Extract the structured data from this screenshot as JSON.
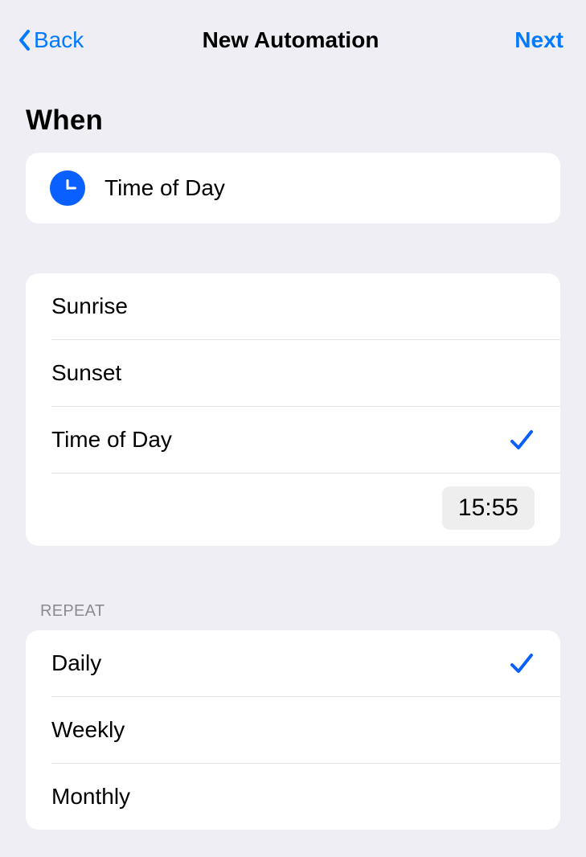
{
  "nav": {
    "back_label": "Back",
    "title": "New Automation",
    "next_label": "Next"
  },
  "when": {
    "header": "When",
    "trigger_label": "Time of Day"
  },
  "time_options": {
    "items": [
      {
        "label": "Sunrise",
        "selected": false
      },
      {
        "label": "Sunset",
        "selected": false
      },
      {
        "label": "Time of Day",
        "selected": true
      }
    ],
    "time_value": "15:55"
  },
  "repeat": {
    "header": "REPEAT",
    "items": [
      {
        "label": "Daily",
        "selected": true
      },
      {
        "label": "Weekly",
        "selected": false
      },
      {
        "label": "Monthly",
        "selected": false
      }
    ]
  },
  "colors": {
    "accent": "#007aff",
    "background": "#efeef4",
    "card": "#ffffff",
    "separator": "#e3e3e7"
  }
}
